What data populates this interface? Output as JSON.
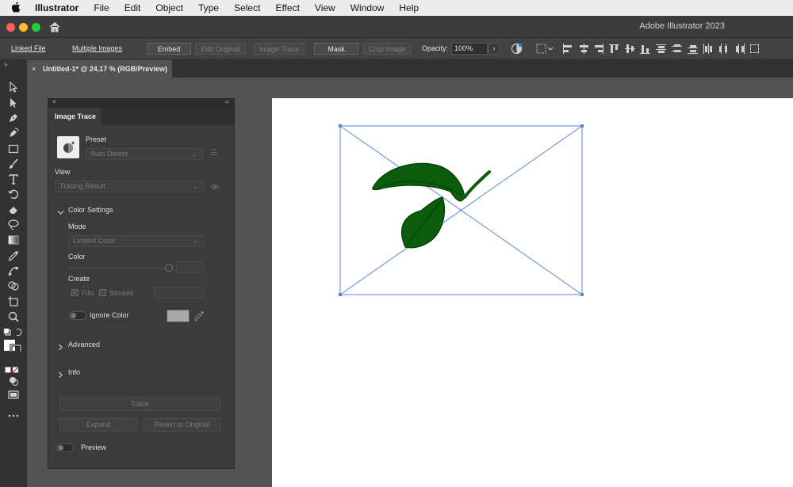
{
  "menubar": {
    "app": "Illustrator",
    "items": [
      "File",
      "Edit",
      "Object",
      "Type",
      "Select",
      "Effect",
      "View",
      "Window",
      "Help"
    ]
  },
  "titlebar": {
    "title": "Adobe Illustrator 2023"
  },
  "controlbar": {
    "linked_file": "Linked File",
    "multiple_images": "Multiple Images",
    "embed": "Embed",
    "edit_original": "Edit Original",
    "image_trace": "Image Trace",
    "mask": "Mask",
    "crop_image": "Crop Image",
    "opacity_label": "Opacity:",
    "opacity_value": "100%",
    "arrow": "›"
  },
  "document": {
    "tab_title": "Untitled-1* @ 24,17 % (RGB/Preview)",
    "close": "×"
  },
  "panel": {
    "tab": "Image Trace",
    "close": "×",
    "collapse": "‹‹",
    "preset_label": "Preset",
    "preset_value": "Auto Detect",
    "view_label": "View",
    "view_value": "Tracing Result",
    "color_settings": "Color Settings",
    "mode_label": "Mode",
    "mode_value": "Limited Color",
    "color_label": "Color",
    "create_label": "Create",
    "fills": "Fills",
    "strokes": "Strokes",
    "ignore_color": "Ignore Color",
    "advanced": "Advanced",
    "info": "Info",
    "trace": "Trace",
    "expand": "Expand",
    "revert": "Revert to Original",
    "preview": "Preview"
  },
  "colors": {
    "leaf": "#0b5c0b",
    "bbox": "#5a86d8",
    "swatch": "#a9a9a9"
  }
}
